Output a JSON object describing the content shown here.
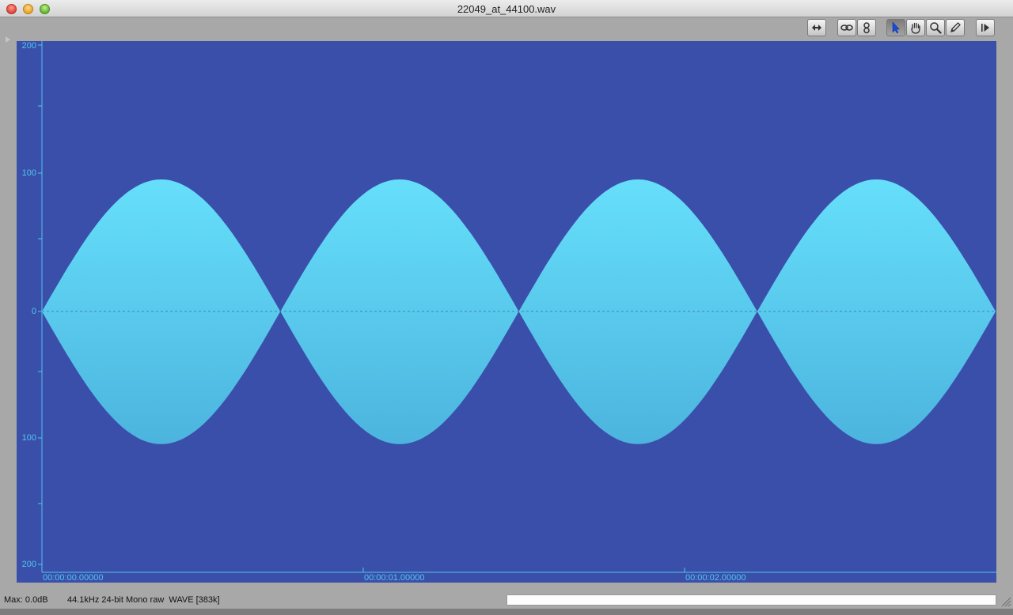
{
  "window": {
    "title": "22049_at_44100.wav"
  },
  "toolbar": {
    "buttons": [
      {
        "icon": "loop-selection-icon"
      },
      {
        "icon": "link-icon"
      },
      {
        "icon": "channels-icon"
      },
      {
        "icon": "arrow-pointer-icon"
      },
      {
        "icon": "hand-icon"
      },
      {
        "icon": "magnifier-icon"
      },
      {
        "icon": "pencil-icon"
      },
      {
        "icon": "play-icon"
      }
    ],
    "active_tool": "arrow-pointer-icon"
  },
  "waveform": {
    "y_axis_labels": {
      "top": "200",
      "upper_mid": "100",
      "zero": "0",
      "lower_mid": "100",
      "bottom": "200"
    },
    "time_labels": [
      "00:00:00.00000",
      "00:00:01.00000",
      "00:00:02.00000"
    ],
    "envelope_peaks": 4,
    "peak_amplitude": 100,
    "colors": {
      "background": "#3a4faa",
      "wave_top": "#66dffb",
      "wave_bottom": "#4cb4de",
      "axis": "#50c6ec"
    }
  },
  "status": {
    "max_level": "Max: 0.0dB",
    "format": "44.1kHz 24-bit Mono raw  WAVE [383k]"
  }
}
